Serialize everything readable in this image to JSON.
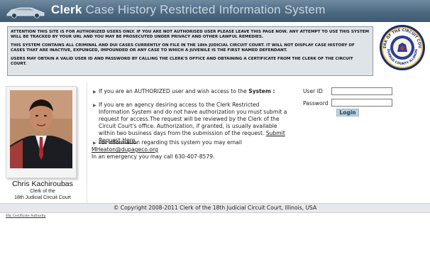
{
  "header": {
    "title_clerk": "Clerk",
    "title_rest": " Case History Restricted Information System"
  },
  "notice": {
    "line1": "ATTENTION THIS SITE IS FOR AUTHORIZED USERS ONLY. IF YOU ARE NOT AUTHORISED USER PLEASE LEAVE THIS PAGE NOW. ANY ATTEMPT TO USE THIS SYSTEM WILL BE TRACKED BY YOUR URL AND YOU MAY BE PROSECUTED UNDER PRIVACY AND OTHER LAWFUL REMEDIES.",
    "line2": "THIS SYSTEM CONTAINS ALL CRIMINAL AND DUI CASES CURRENTLY ON FILE IN THE 18th JUDICIAL CIRCUIT COURT. IT WILL NOT DISPLAY CASE HISTORY OF CASES THAT ARE INACTIVE, EXPUNGED, IMPOUNDED OR ANY CASE TO WHICH A JUVENILE IS THE FIRST NAMED DEFENDANT.",
    "line3": "USERS MAY OBTAIN A VALID USER ID AND PASSWORD BY CALLING THE CLERK'S OFFICE AND OBTAINING A CERTIFICATE FROM THE CLERK OF THE CIRCUIT COURT."
  },
  "seal": {
    "top_text": "CLERK OF THE CIRCUIT COURT",
    "bottom_text": "DUPAGE COUNTY ILLINOIS"
  },
  "profile": {
    "name": "Chris Kachiroubas",
    "caption1": "Clerk of the",
    "caption2": "18th Judicial Circuit Court"
  },
  "info": {
    "authorized_prefix": "If you are an AUTHORIZED user and wish access to the ",
    "authorized_bold": "System :",
    "agency_text": "If you are an agency desiring access to the Clerk Restricted Information System and do not have authorization you must submit a request for access.The request will be reviewed by the Clerk of the Circuit Court's office. Authorization, if granted, is usually available within two business days from the submission of the request. ",
    "request_link": "Submit Request Here.",
    "contact_prefix": "For information regarding this system you may email",
    "email": "MHeaton@dupageco.org",
    "emergency": "In an emergency you may call 630-407-8579."
  },
  "login": {
    "user_label": "User ID",
    "user_value": "",
    "password_label": "Password",
    "password_value": "",
    "button_label": "Login"
  },
  "footer": {
    "copyright": "© Copyright 2008-2011 Clerk of the 18th Judicial Circuit Court, Illinois, USA",
    "ssl_link": "SSL Certificate Authority"
  }
}
